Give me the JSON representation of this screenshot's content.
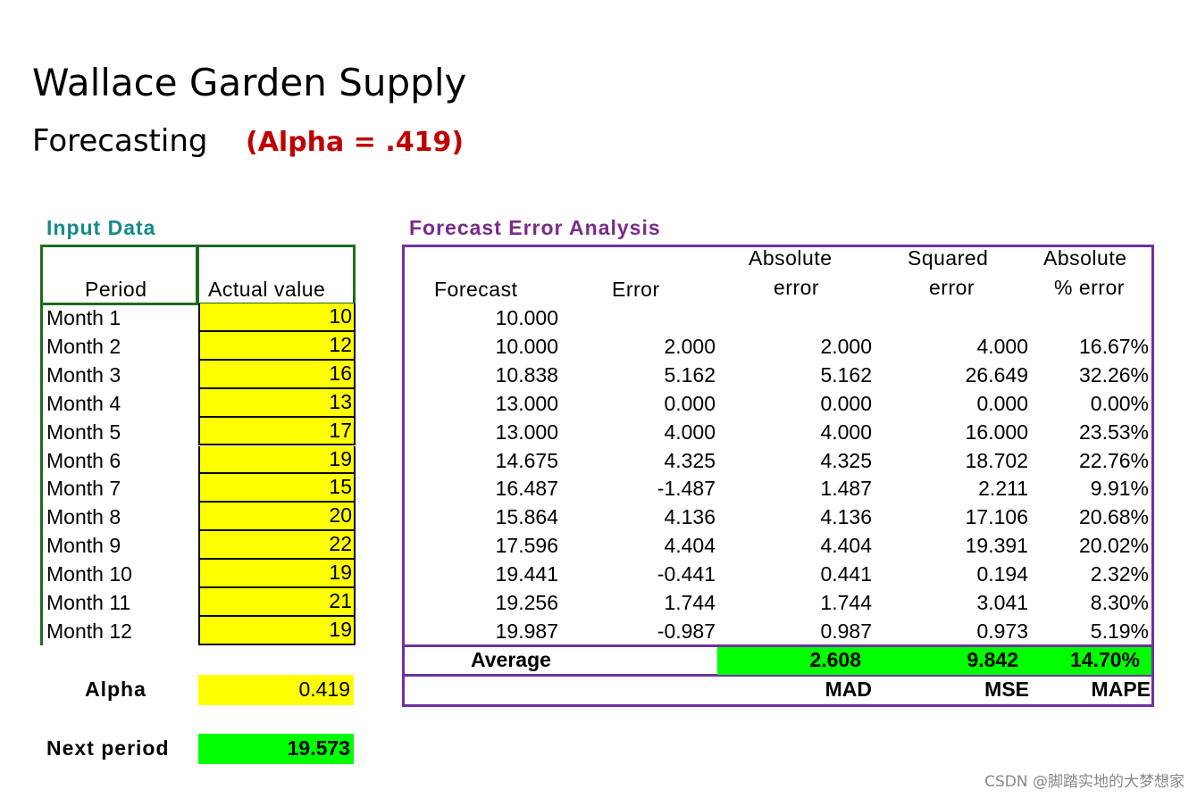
{
  "title": "Wallace Garden Supply",
  "subtitle": "Forecasting",
  "alpha_note": "(Alpha = .419)",
  "input": {
    "section_label": "Input Data",
    "col_period": "Period",
    "col_actual": "Actual value",
    "rows": [
      {
        "period": "Month 1",
        "actual": "10"
      },
      {
        "period": "Month 2",
        "actual": "12"
      },
      {
        "period": "Month 3",
        "actual": "16"
      },
      {
        "period": "Month 4",
        "actual": "13"
      },
      {
        "period": "Month 5",
        "actual": "17"
      },
      {
        "period": "Month 6",
        "actual": "19"
      },
      {
        "period": "Month 7",
        "actual": "15"
      },
      {
        "period": "Month 8",
        "actual": "20"
      },
      {
        "period": "Month 9",
        "actual": "22"
      },
      {
        "period": "Month 10",
        "actual": "19"
      },
      {
        "period": "Month 11",
        "actual": "21"
      },
      {
        "period": "Month 12",
        "actual": "19"
      }
    ],
    "alpha_label": "Alpha",
    "alpha_value": "0.419",
    "next_label": "Next period",
    "next_value": "19.573"
  },
  "analysis": {
    "section_label": "Forecast Error Analysis",
    "col_forecast": "Forecast",
    "col_error": "Error",
    "col_abs_1": "Absolute",
    "col_abs_2": "error",
    "col_sq_1": "Squared",
    "col_sq_2": "error",
    "col_pct_1": "Absolute",
    "col_pct_2": "% error",
    "rows": [
      {
        "forecast": "10.000",
        "error": "",
        "abs": "",
        "sq": "",
        "pct": ""
      },
      {
        "forecast": "10.000",
        "error": "2.000",
        "abs": "2.000",
        "sq": "4.000",
        "pct": "16.67%"
      },
      {
        "forecast": "10.838",
        "error": "5.162",
        "abs": "5.162",
        "sq": "26.649",
        "pct": "32.26%"
      },
      {
        "forecast": "13.000",
        "error": "0.000",
        "abs": "0.000",
        "sq": "0.000",
        "pct": "0.00%"
      },
      {
        "forecast": "13.000",
        "error": "4.000",
        "abs": "4.000",
        "sq": "16.000",
        "pct": "23.53%"
      },
      {
        "forecast": "14.675",
        "error": "4.325",
        "abs": "4.325",
        "sq": "18.702",
        "pct": "22.76%"
      },
      {
        "forecast": "16.487",
        "error": "-1.487",
        "abs": "1.487",
        "sq": "2.211",
        "pct": "9.91%"
      },
      {
        "forecast": "15.864",
        "error": "4.136",
        "abs": "4.136",
        "sq": "17.106",
        "pct": "20.68%"
      },
      {
        "forecast": "17.596",
        "error": "4.404",
        "abs": "4.404",
        "sq": "19.391",
        "pct": "20.02%"
      },
      {
        "forecast": "19.441",
        "error": "-0.441",
        "abs": "0.441",
        "sq": "0.194",
        "pct": "2.32%"
      },
      {
        "forecast": "19.256",
        "error": "1.744",
        "abs": "1.744",
        "sq": "3.041",
        "pct": "8.30%"
      },
      {
        "forecast": "19.987",
        "error": "-0.987",
        "abs": "0.987",
        "sq": "0.973",
        "pct": "5.19%"
      }
    ],
    "average_label": "Average",
    "avg_abs": "2.608",
    "avg_sq": "9.842",
    "avg_pct": "14.70%",
    "mad_label": "MAD",
    "mse_label": "MSE",
    "mape_label": "MAPE"
  },
  "watermark": "CSDN @脚踏实地的大梦想家",
  "colors": {
    "accent_red": "#c00000",
    "input_teal": "#138a8a",
    "analysis_purple": "#7a2a8a",
    "yellow": "#ffff00",
    "green": "#00ff00"
  }
}
